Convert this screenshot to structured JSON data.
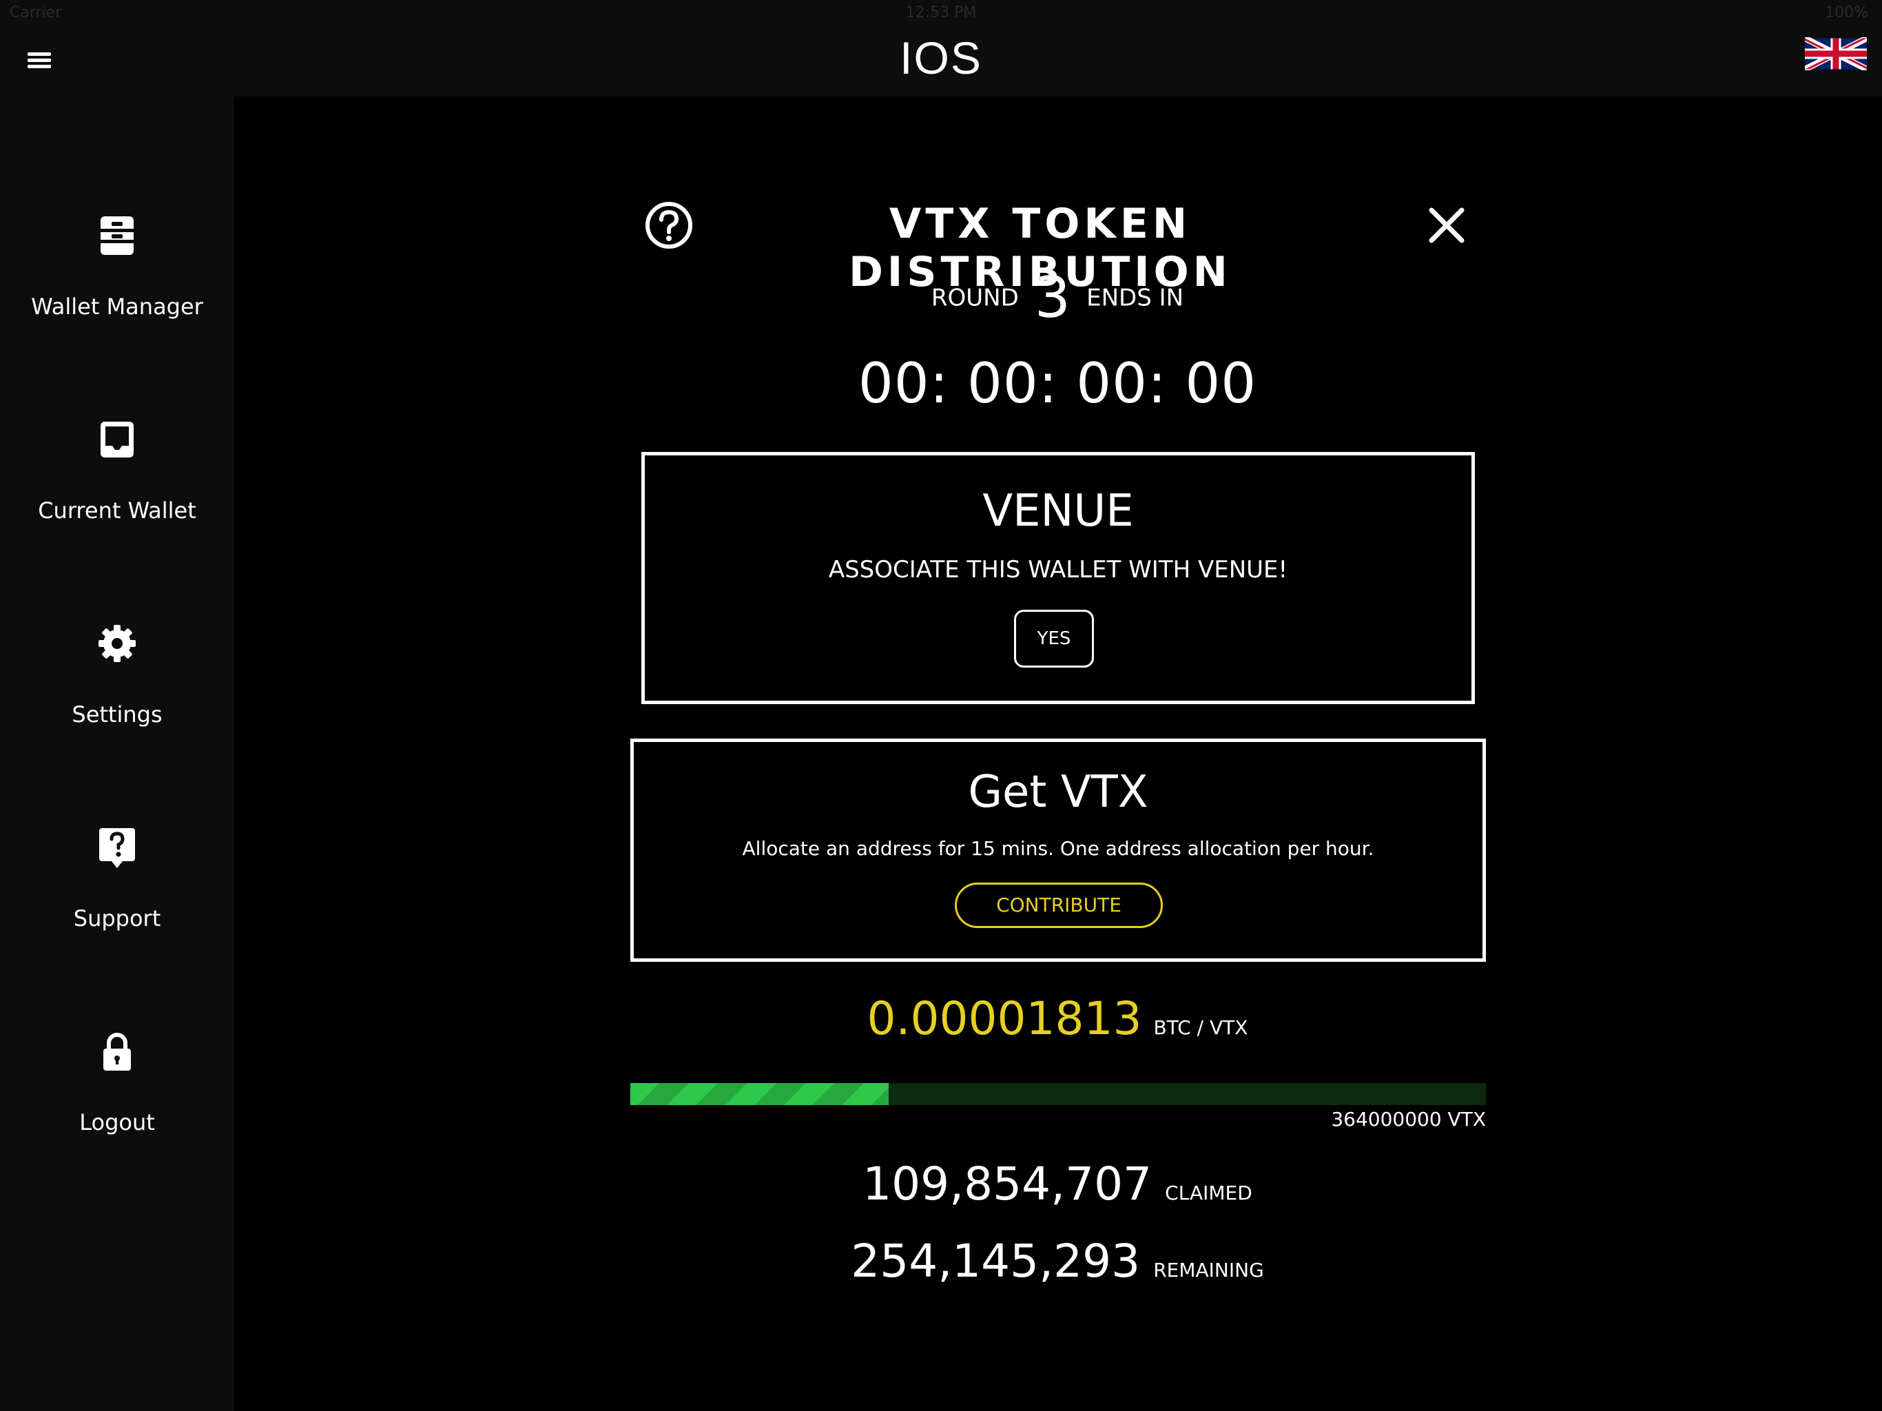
{
  "status_bar": {
    "carrier": "Carrier",
    "time": "12:53 PM",
    "battery": "100%"
  },
  "header": {
    "title": "IOS",
    "language_flag": "uk-flag-icon"
  },
  "sidebar": {
    "items": [
      {
        "label": "Wallet Manager",
        "icon": "wallet-manager-icon"
      },
      {
        "label": "Current Wallet",
        "icon": "current-wallet-icon"
      },
      {
        "label": "Settings",
        "icon": "gear-icon"
      },
      {
        "label": "Support",
        "icon": "support-icon"
      },
      {
        "label": "Logout",
        "icon": "lock-icon"
      }
    ]
  },
  "distribution": {
    "title": "VTX TOKEN DISTRIBUTION",
    "round_label": "ROUND",
    "round_number": "3",
    "ends_in_label": "ENDS IN",
    "countdown": "00: 00: 00: 00",
    "venue": {
      "title": "VENUE",
      "subtitle": "ASSOCIATE THIS WALLET WITH VENUE!",
      "button_label": "YES"
    },
    "get_vtx": {
      "title": "Get VTX",
      "subtitle": "Allocate an address for 15 mins. One address allocation per hour.",
      "button_label": "CONTRIBUTE"
    },
    "rate_value": "0.00001813",
    "rate_unit": "BTC / VTX",
    "progress_fraction": 0.3018,
    "total_supply": "364000000 VTX",
    "claimed_value": "109,854,707",
    "claimed_label": "CLAIMED",
    "remaining_value": "254,145,293",
    "remaining_label": "REMAINING"
  },
  "colors": {
    "accent_yellow": "#e6d021",
    "progress_green": "#2ec84a",
    "sidebar_bg": "#0d0d0d",
    "main_bg": "#000000"
  }
}
